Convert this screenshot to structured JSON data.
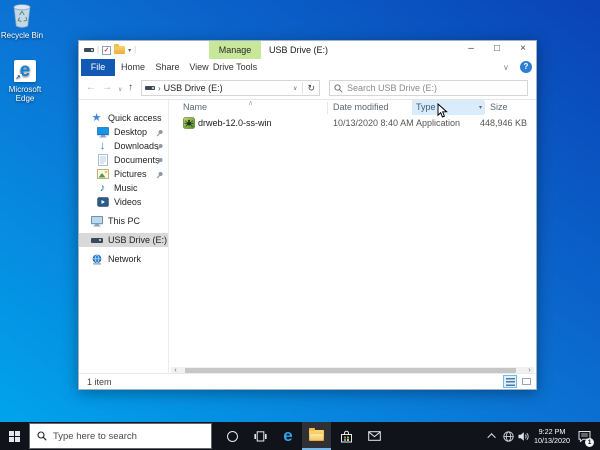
{
  "desktop": {
    "icons": [
      {
        "label": "Recycle Bin"
      },
      {
        "label": "Microsoft Edge"
      }
    ]
  },
  "explorer": {
    "title": "USB Drive (E:)",
    "contextual_tab": "Manage",
    "tabs": {
      "file": "File",
      "home": "Home",
      "share": "Share",
      "view": "View",
      "drive_tools": "Drive Tools"
    },
    "address": {
      "path": "USB Drive (E:)",
      "separator": "›"
    },
    "search_placeholder": "Search USB Drive (E:)",
    "sidebar": {
      "items": [
        {
          "label": "Quick access"
        },
        {
          "label": "Desktop"
        },
        {
          "label": "Downloads"
        },
        {
          "label": "Documents"
        },
        {
          "label": "Pictures"
        },
        {
          "label": "Music"
        },
        {
          "label": "Videos"
        },
        {
          "label": "This PC"
        },
        {
          "label": "USB Drive (E:)"
        },
        {
          "label": "Network"
        }
      ]
    },
    "columns": {
      "name": "Name",
      "date": "Date modified",
      "type": "Type",
      "size": "Size"
    },
    "files": [
      {
        "name": "drweb-12.0-ss-win",
        "date": "10/13/2020 8:40 AM",
        "type": "Application",
        "size": "448,946 KB"
      }
    ],
    "status_bar": {
      "items_count": "1 item"
    }
  },
  "taskbar": {
    "search_placeholder": "Type here to search",
    "clock": {
      "time": "9:22 PM",
      "date": "10/13/2020"
    },
    "notification_badge": "1"
  },
  "glyphs": {
    "back": "←",
    "forward": "→",
    "up": "↑",
    "refresh": "↻",
    "chevron_down": "∨",
    "dropdown": "▾",
    "sort_asc": "∧",
    "minimize": "–",
    "maximize": "□",
    "close": "×",
    "help": "?",
    "scroll_left": "‹",
    "scroll_right": "›",
    "star": "★",
    "down_arrow": "↓",
    "music_note": "♪",
    "check": "✓",
    "shortcut_arrow": "↗",
    "edge_e": "e"
  }
}
